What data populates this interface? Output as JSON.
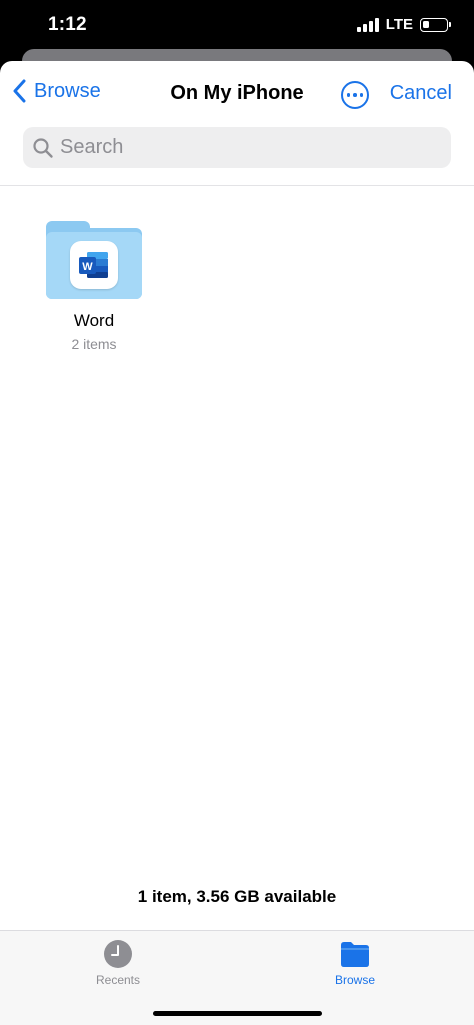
{
  "status_bar": {
    "time": "1:12",
    "network": "LTE",
    "battery_level": 0.3
  },
  "nav": {
    "back_label": "Browse",
    "title": "On My iPhone",
    "more_icon": "ellipsis-circle-icon",
    "cancel_label": "Cancel"
  },
  "search": {
    "placeholder": "Search",
    "value": ""
  },
  "items": [
    {
      "name": "Word",
      "detail": "2 items",
      "icon": "folder-icon",
      "badge": "word-app-icon"
    }
  ],
  "footer": {
    "storage_text": "1 item, 3.56 GB available"
  },
  "tabs": [
    {
      "label": "Recents",
      "icon": "clock-icon",
      "active": false
    },
    {
      "label": "Browse",
      "icon": "folder-icon",
      "active": true
    }
  ],
  "colors": {
    "accent": "#1a73e8",
    "folder": "#a5d8f7",
    "word_blue": "#2b579a",
    "secondary_text": "#8e8e93"
  }
}
